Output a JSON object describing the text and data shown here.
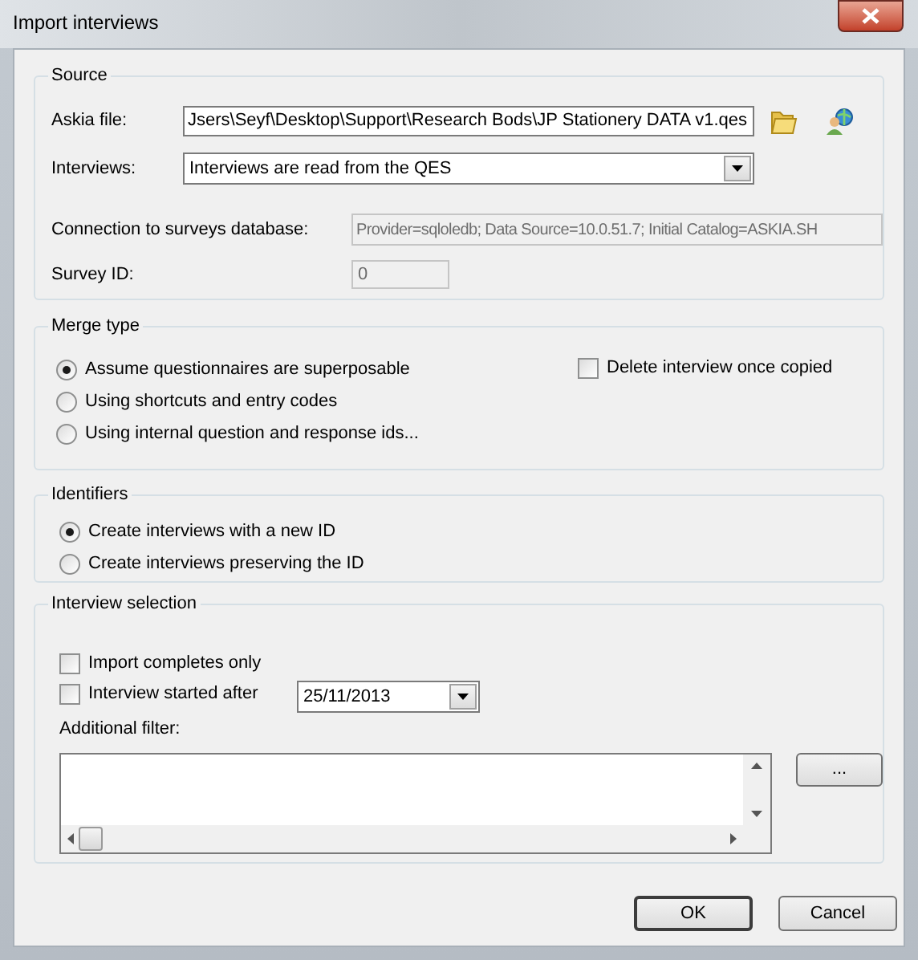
{
  "window": {
    "title": "Import interviews"
  },
  "source": {
    "legend": "Source",
    "askia_file": {
      "label": "Askia file:",
      "value": "Jsers\\Seyf\\Desktop\\Support\\Research Bods\\JP Stationery DATA v1.qes"
    },
    "interviews": {
      "label": "Interviews:",
      "value": "Interviews are read from the QES"
    },
    "connection": {
      "label": "Connection to surveys database:",
      "value": "Provider=sqloledb; Data Source=10.0.51.7; Initial Catalog=ASKIA.SH",
      "disabled": true
    },
    "survey_id": {
      "label": "Survey ID:",
      "value": "0",
      "disabled": true
    }
  },
  "merge_type": {
    "legend": "Merge type",
    "options": [
      {
        "label": "Assume questionnaires are superposable",
        "selected": true
      },
      {
        "label": "Using shortcuts and entry codes",
        "selected": false
      },
      {
        "label": "Using internal question and response ids...",
        "selected": false
      }
    ],
    "delete_once_copied": {
      "label": "Delete interview once copied",
      "checked": false
    }
  },
  "identifiers": {
    "legend": "Identifiers",
    "options": [
      {
        "label": "Create interviews with a new ID",
        "selected": true
      },
      {
        "label": "Create interviews preserving the ID",
        "selected": false
      }
    ]
  },
  "interview_selection": {
    "legend": "Interview selection",
    "import_completes_only": {
      "label": "Import completes only",
      "checked": false
    },
    "started_after": {
      "label": "Interview started after",
      "checked": false,
      "date": "25/11/2013"
    },
    "additional_filter": {
      "label": "Additional filter:"
    },
    "browse_button": "..."
  },
  "buttons": [
    {
      "label": "OK",
      "default": true
    },
    {
      "label": "Cancel",
      "default": false
    }
  ]
}
